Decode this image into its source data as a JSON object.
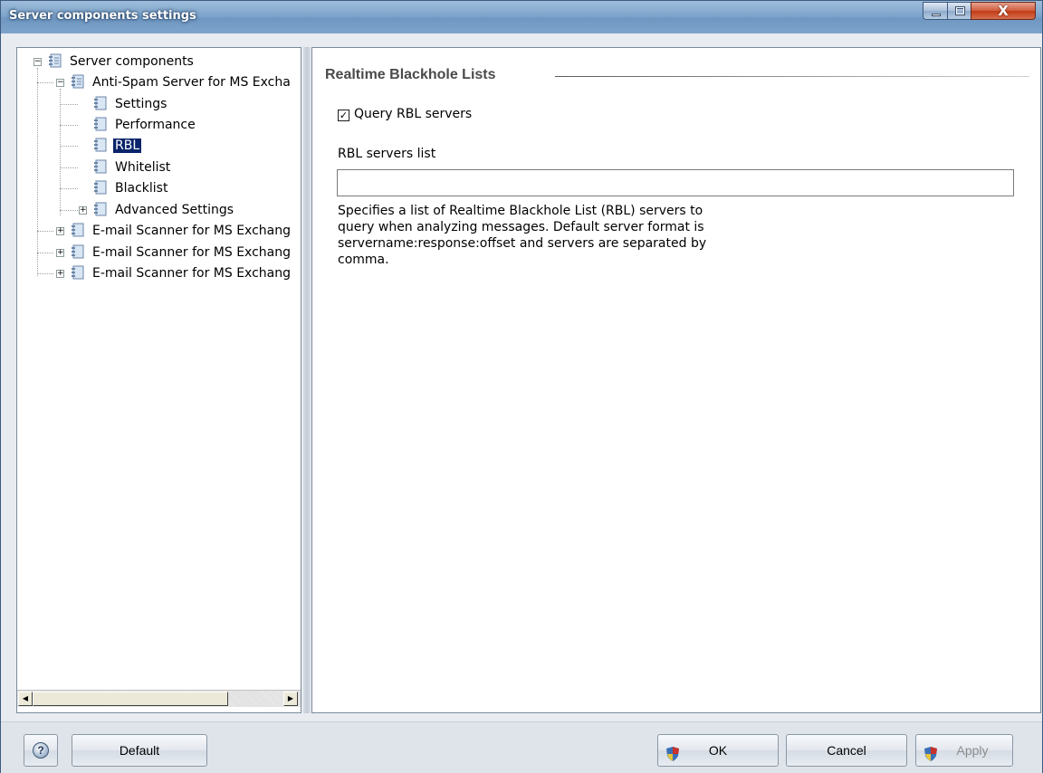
{
  "window": {
    "title": "Server components settings",
    "close_glyph": "X"
  },
  "tree": {
    "root": {
      "label": "Server components",
      "expander": "−"
    },
    "antispam": {
      "label": "Anti-Spam Server for MS Excha",
      "expander": "−"
    },
    "children": [
      {
        "label": "Settings"
      },
      {
        "label": "Performance"
      },
      {
        "label": "RBL",
        "selected": true
      },
      {
        "label": "Whitelist"
      },
      {
        "label": "Blacklist"
      },
      {
        "label": "Advanced Settings",
        "expander": "+"
      }
    ],
    "scanners": [
      {
        "label": "E-mail Scanner for MS Exchang",
        "expander": "+"
      },
      {
        "label": "E-mail Scanner for MS Exchang",
        "expander": "+"
      },
      {
        "label": "E-mail Scanner for MS Exchang",
        "expander": "+"
      }
    ]
  },
  "main": {
    "section_title": "Realtime Blackhole Lists",
    "query_rbl": {
      "label": "Query RBL servers",
      "checked": true,
      "check_glyph": "✓"
    },
    "servers_list": {
      "label": "RBL servers list",
      "value": ""
    },
    "description": "Specifies a list of Realtime Blackhole List (RBL) servers to query when analyzing messages. Default server format is servername:response:offset and servers are separated by comma."
  },
  "buttons": {
    "help": "?",
    "default": "Default",
    "ok": "OK",
    "cancel": "Cancel",
    "apply": "Apply"
  },
  "scrollbar": {
    "left_arrow": "◀",
    "right_arrow": "▶"
  },
  "colors": {
    "selection": "#0a246a",
    "title_bar": "#6f97c1",
    "shield_blue": "#3a6fb8",
    "shield_red": "#c8322a",
    "shield_yellow": "#e8c43a"
  }
}
